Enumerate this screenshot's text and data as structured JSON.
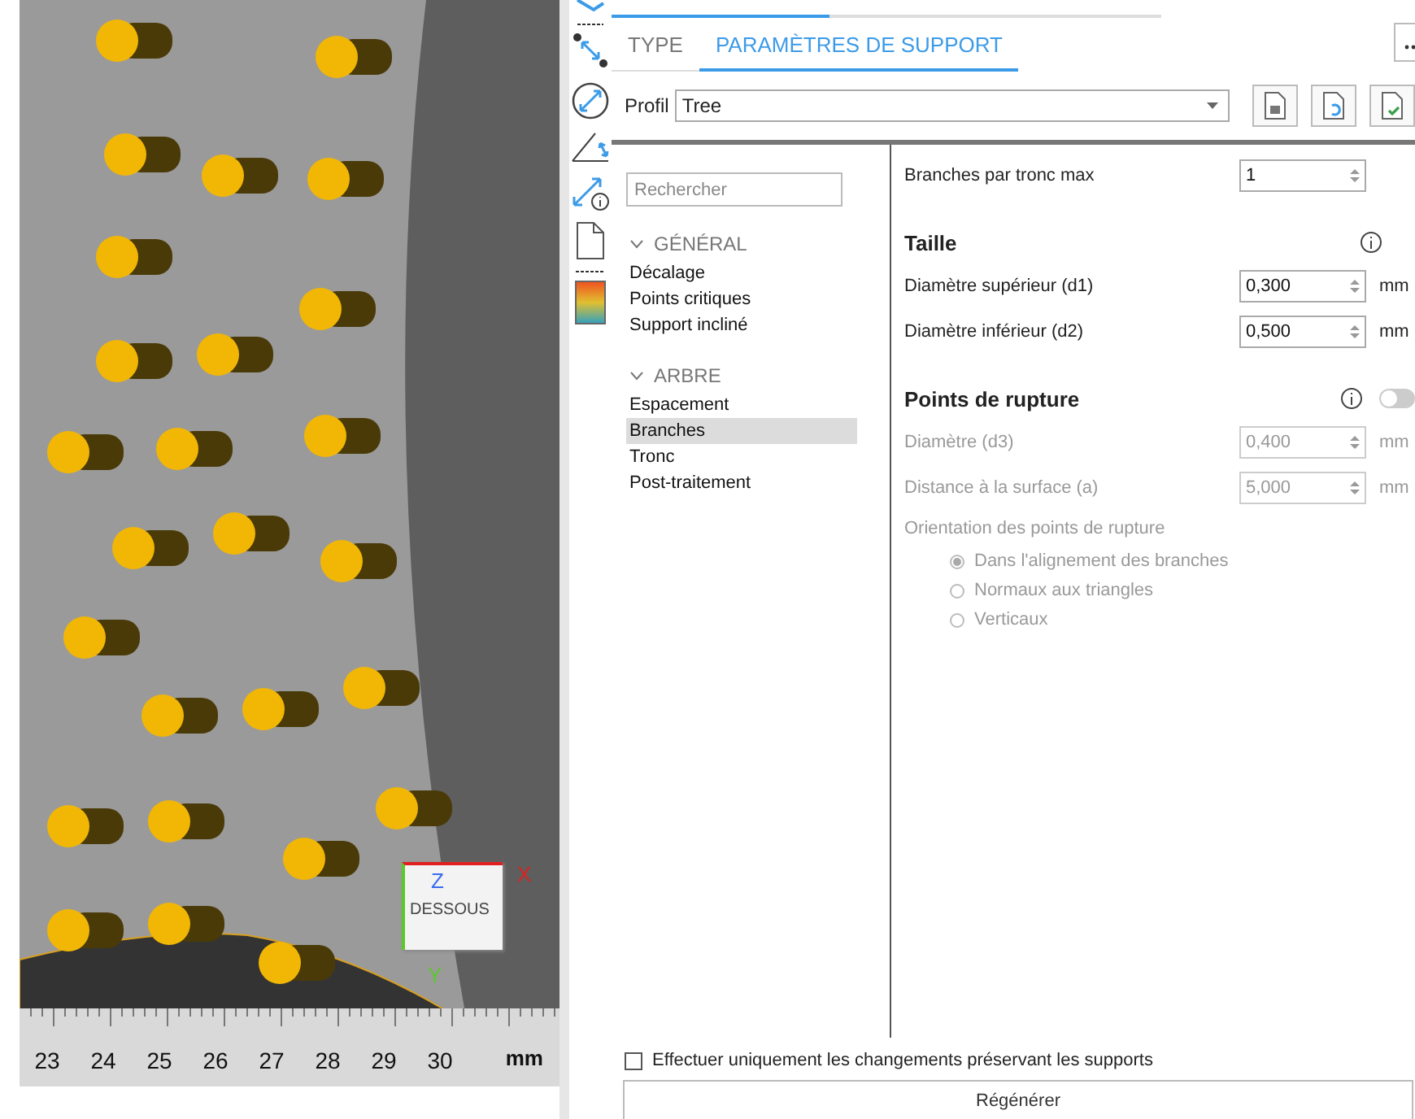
{
  "viewport": {
    "ruler": [
      "23",
      "24",
      "25",
      "26",
      "27",
      "28",
      "29",
      "30"
    ],
    "unit": "mm",
    "cube": {
      "face": "DESSOUS",
      "axes": [
        {
          "label": "Z",
          "color": "#3a6cf0"
        },
        {
          "label": "X",
          "color": "#e02020"
        },
        {
          "label": "Y",
          "color": "#5cc92a"
        }
      ]
    }
  },
  "tabs": [
    {
      "label": "TYPE",
      "selected": false
    },
    {
      "label": "PARAMÈTRES DE SUPPORT",
      "selected": true
    }
  ],
  "profile": {
    "label": "Profil",
    "value": "Tree"
  },
  "search": {
    "placeholder": "Rechercher"
  },
  "tree": [
    {
      "label": "GÉNÉRAL",
      "expanded": true,
      "children": [
        {
          "label": "Décalage",
          "selected": false
        },
        {
          "label": "Points critiques",
          "selected": false
        },
        {
          "label": "Support incliné",
          "selected": false
        }
      ]
    },
    {
      "label": "ARBRE",
      "expanded": true,
      "children": [
        {
          "label": "Espacement",
          "selected": false
        },
        {
          "label": "Branches",
          "selected": true
        },
        {
          "label": "Tronc",
          "selected": false
        },
        {
          "label": "Post-traitement",
          "selected": false
        }
      ]
    }
  ],
  "settings": [
    {
      "kind": "spinner",
      "label": "Branches par tronc max",
      "value": "1",
      "disabled": false
    },
    {
      "kind": "section",
      "title": "Taille",
      "info": true
    },
    {
      "kind": "spinner",
      "label": "Diamètre supérieur (d1)",
      "value": "0,300",
      "unit": "mm",
      "disabled": false
    },
    {
      "kind": "spinner",
      "label": "Diamètre inférieur (d2)",
      "value": "0,500",
      "unit": "mm",
      "disabled": false
    },
    {
      "kind": "section",
      "title": "Points de rupture",
      "info": true,
      "toggle": {
        "on": false
      }
    },
    {
      "kind": "spinner",
      "label": "Diamètre (d3)",
      "value": "0,400",
      "unit": "mm",
      "disabled": true
    },
    {
      "kind": "spinner",
      "label": "Distance à la surface (a)",
      "value": "5,000",
      "unit": "mm",
      "disabled": true
    },
    {
      "kind": "caption",
      "label": "Orientation des points de rupture",
      "disabled": true
    },
    {
      "kind": "radio",
      "label": "Dans l'alignement des branches",
      "selected": true,
      "disabled": true
    },
    {
      "kind": "radio",
      "label": "Normaux aux triangles",
      "selected": false,
      "disabled": true
    },
    {
      "kind": "radio",
      "label": "Verticaux",
      "selected": false,
      "disabled": true
    }
  ],
  "footer": {
    "checkbox": {
      "label": "Effectuer uniquement les changements préservant les supports",
      "checked": false
    },
    "button": "Régénérer"
  }
}
